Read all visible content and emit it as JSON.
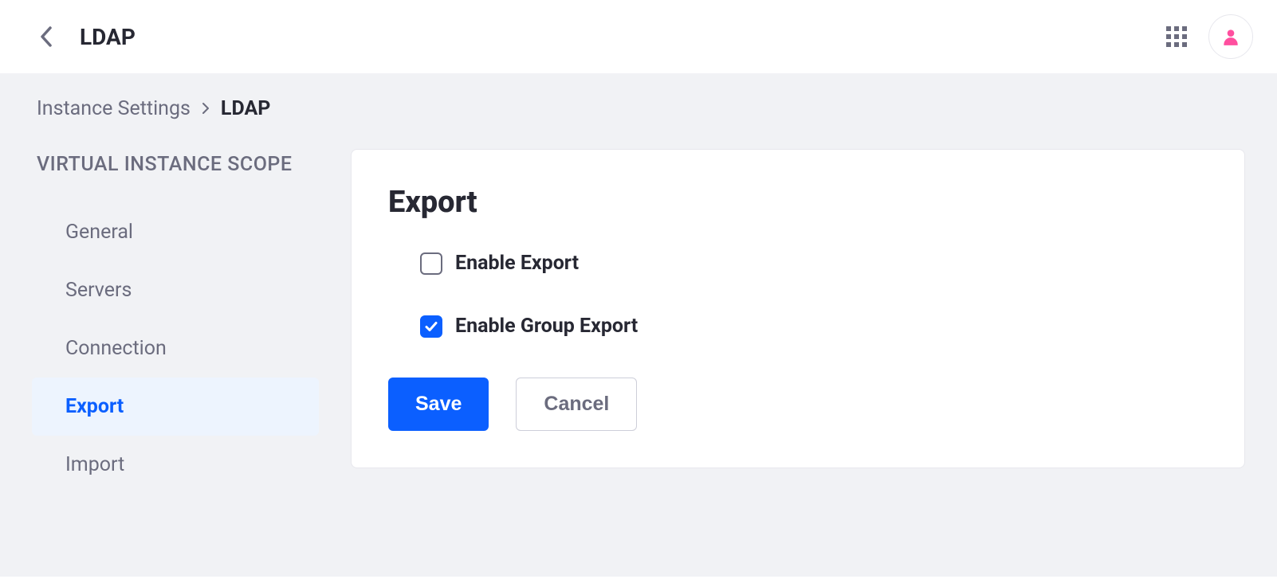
{
  "header": {
    "title": "LDAP"
  },
  "breadcrumb": {
    "parent": "Instance Settings",
    "current": "LDAP"
  },
  "sidebar": {
    "heading": "VIRTUAL INSTANCE SCOPE",
    "items": [
      {
        "label": "General",
        "active": false
      },
      {
        "label": "Servers",
        "active": false
      },
      {
        "label": "Connection",
        "active": false
      },
      {
        "label": "Export",
        "active": true
      },
      {
        "label": "Import",
        "active": false
      }
    ]
  },
  "panel": {
    "title": "Export",
    "checkboxes": [
      {
        "label": "Enable Export",
        "checked": false
      },
      {
        "label": "Enable Group Export",
        "checked": true
      }
    ],
    "buttons": {
      "save": "Save",
      "cancel": "Cancel"
    }
  }
}
